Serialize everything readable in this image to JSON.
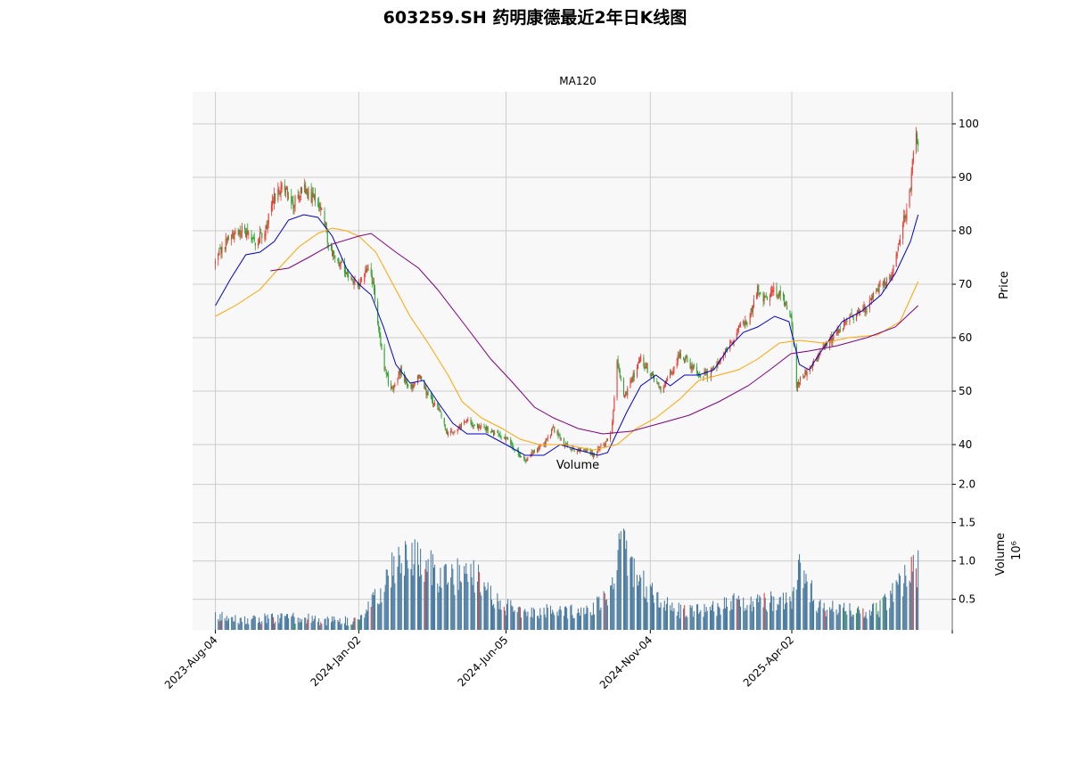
{
  "title": "603259.SH 药明康德最近2年日K线图",
  "chart_data": [
    {
      "type": "candlestick",
      "title": "MA120",
      "ylabel": "Price",
      "ylim": [
        34,
        106
      ],
      "yticks": [
        40,
        50,
        60,
        70,
        80,
        90,
        100
      ],
      "xlim": [
        "2023-07-11",
        "2025-09-18"
      ],
      "xticks": [
        "2023-Aug-04",
        "2024-Jan-02",
        "2024-Jun-05",
        "2024-Nov-04",
        "2025-Apr-02"
      ],
      "grid": true,
      "colors": {
        "up": "#e8382f",
        "down": "#2ca02c",
        "background": "#f8f8f8",
        "grid": "#cccccc"
      },
      "close_anchors": [
        [
          "2023-08-04",
          74
        ],
        [
          "2023-08-15",
          78
        ],
        [
          "2023-09-01",
          80
        ],
        [
          "2023-09-15",
          78
        ],
        [
          "2023-09-25",
          80
        ],
        [
          "2023-10-05",
          86
        ],
        [
          "2023-10-15",
          89
        ],
        [
          "2023-10-25",
          85
        ],
        [
          "2023-11-05",
          88
        ],
        [
          "2023-11-15",
          86
        ],
        [
          "2023-11-25",
          84
        ],
        [
          "2023-12-01",
          77
        ],
        [
          "2023-12-10",
          75
        ],
        [
          "2023-12-20",
          72
        ],
        [
          "2024-01-02",
          70
        ],
        [
          "2024-01-10",
          73
        ],
        [
          "2024-01-15",
          72
        ],
        [
          "2024-01-20",
          66
        ],
        [
          "2024-01-28",
          55
        ],
        [
          "2024-02-05",
          50
        ],
        [
          "2024-02-15",
          54
        ],
        [
          "2024-02-25",
          50
        ],
        [
          "2024-03-05",
          53
        ],
        [
          "2024-03-15",
          49
        ],
        [
          "2024-03-25",
          47
        ],
        [
          "2024-04-05",
          42
        ],
        [
          "2024-04-15",
          43
        ],
        [
          "2024-04-25",
          45
        ],
        [
          "2024-05-05",
          43
        ],
        [
          "2024-05-15",
          43
        ],
        [
          "2024-05-25",
          42
        ],
        [
          "2024-06-05",
          41
        ],
        [
          "2024-06-15",
          39
        ],
        [
          "2024-06-25",
          37
        ],
        [
          "2024-07-05",
          39
        ],
        [
          "2024-07-15",
          40
        ],
        [
          "2024-07-25",
          43
        ],
        [
          "2024-08-05",
          40
        ],
        [
          "2024-08-15",
          39
        ],
        [
          "2024-08-25",
          39
        ],
        [
          "2024-09-05",
          38
        ],
        [
          "2024-09-15",
          40
        ],
        [
          "2024-09-24",
          42
        ],
        [
          "2024-09-30",
          55
        ],
        [
          "2024-10-08",
          49
        ],
        [
          "2024-10-15",
          52
        ],
        [
          "2024-10-25",
          56
        ],
        [
          "2024-11-05",
          53
        ],
        [
          "2024-11-15",
          50
        ],
        [
          "2024-11-25",
          53
        ],
        [
          "2024-12-05",
          57
        ],
        [
          "2024-12-15",
          55
        ],
        [
          "2024-12-25",
          53
        ],
        [
          "2025-01-05",
          53
        ],
        [
          "2025-01-15",
          56
        ],
        [
          "2025-01-25",
          58
        ],
        [
          "2025-02-05",
          62
        ],
        [
          "2025-02-15",
          63
        ],
        [
          "2025-02-25",
          69
        ],
        [
          "2025-03-05",
          67
        ],
        [
          "2025-03-15",
          69
        ],
        [
          "2025-03-25",
          67
        ],
        [
          "2025-04-02",
          63
        ],
        [
          "2025-04-07",
          51
        ],
        [
          "2025-04-15",
          53
        ],
        [
          "2025-04-25",
          55
        ],
        [
          "2025-05-05",
          58
        ],
        [
          "2025-05-15",
          60
        ],
        [
          "2025-05-25",
          62
        ],
        [
          "2025-06-05",
          64
        ],
        [
          "2025-06-15",
          65
        ],
        [
          "2025-06-25",
          67
        ],
        [
          "2025-07-05",
          70
        ],
        [
          "2025-07-15",
          71
        ],
        [
          "2025-07-20",
          75
        ],
        [
          "2025-07-25",
          79
        ],
        [
          "2025-08-01",
          84
        ],
        [
          "2025-08-06",
          90
        ],
        [
          "2025-08-10",
          98
        ],
        [
          "2025-08-13",
          96
        ]
      ],
      "moving_averages": [
        {
          "color": "#0000cc",
          "points": [
            [
              "2023-08-04",
              66
            ],
            [
              "2023-08-20",
              71
            ],
            [
              "2023-09-05",
              75.5
            ],
            [
              "2023-09-20",
              76
            ],
            [
              "2023-10-05",
              78
            ],
            [
              "2023-10-20",
              82
            ],
            [
              "2023-11-05",
              83
            ],
            [
              "2023-11-20",
              82.5
            ],
            [
              "2023-12-05",
              79
            ],
            [
              "2023-12-20",
              73
            ],
            [
              "2024-01-02",
              70
            ],
            [
              "2024-01-15",
              68
            ],
            [
              "2024-01-28",
              62
            ],
            [
              "2024-02-10",
              55
            ],
            [
              "2024-02-25",
              51.5
            ],
            [
              "2024-03-10",
              52
            ],
            [
              "2024-03-25",
              48
            ],
            [
              "2024-04-10",
              44
            ],
            [
              "2024-04-25",
              42
            ],
            [
              "2024-05-15",
              42
            ],
            [
              "2024-06-05",
              40
            ],
            [
              "2024-06-25",
              38
            ],
            [
              "2024-07-15",
              38
            ],
            [
              "2024-08-01",
              40
            ],
            [
              "2024-08-20",
              39
            ],
            [
              "2024-09-10",
              38
            ],
            [
              "2024-09-20",
              38.5
            ],
            [
              "2024-10-10",
              46
            ],
            [
              "2024-10-25",
              51
            ],
            [
              "2024-11-10",
              53
            ],
            [
              "2024-11-25",
              51
            ],
            [
              "2024-12-10",
              53
            ],
            [
              "2024-12-25",
              53
            ],
            [
              "2025-01-10",
              54
            ],
            [
              "2025-01-25",
              58
            ],
            [
              "2025-02-10",
              61
            ],
            [
              "2025-02-25",
              62
            ],
            [
              "2025-03-15",
              64
            ],
            [
              "2025-03-30",
              63
            ],
            [
              "2025-04-10",
              55
            ],
            [
              "2025-04-20",
              54
            ],
            [
              "2025-05-05",
              58
            ],
            [
              "2025-05-25",
              63
            ],
            [
              "2025-06-15",
              65
            ],
            [
              "2025-07-05",
              68
            ],
            [
              "2025-07-20",
              72
            ],
            [
              "2025-08-05",
              78
            ],
            [
              "2025-08-13",
              83
            ]
          ]
        },
        {
          "color": "#ffa500",
          "points": [
            [
              "2023-08-04",
              64
            ],
            [
              "2023-08-25",
              66
            ],
            [
              "2023-09-20",
              69
            ],
            [
              "2023-10-10",
              73
            ],
            [
              "2023-10-31",
              77
            ],
            [
              "2023-11-20",
              79.5
            ],
            [
              "2023-12-05",
              80.5
            ],
            [
              "2023-12-20",
              80
            ],
            [
              "2024-01-02",
              79
            ],
            [
              "2024-01-20",
              76
            ],
            [
              "2024-02-10",
              69
            ],
            [
              "2024-02-25",
              64
            ],
            [
              "2024-03-15",
              59
            ],
            [
              "2024-04-05",
              53
            ],
            [
              "2024-04-20",
              48
            ],
            [
              "2024-05-10",
              45
            ],
            [
              "2024-06-01",
              43
            ],
            [
              "2024-06-20",
              41
            ],
            [
              "2024-07-10",
              40
            ],
            [
              "2024-08-05",
              40
            ],
            [
              "2024-09-05",
              39
            ],
            [
              "2024-09-30",
              40
            ],
            [
              "2024-10-20",
              43
            ],
            [
              "2024-11-10",
              45
            ],
            [
              "2024-12-05",
              48.5
            ],
            [
              "2024-12-25",
              52
            ],
            [
              "2025-01-15",
              53
            ],
            [
              "2025-02-05",
              54
            ],
            [
              "2025-02-25",
              56
            ],
            [
              "2025-03-20",
              59
            ],
            [
              "2025-04-10",
              59.5
            ],
            [
              "2025-05-05",
              59
            ],
            [
              "2025-06-01",
              60
            ],
            [
              "2025-07-01",
              60.5
            ],
            [
              "2025-07-25",
              63
            ],
            [
              "2025-08-13",
              70.5
            ]
          ]
        },
        {
          "color": "#800080",
          "points": [
            [
              "2023-10-01",
              72.5
            ],
            [
              "2023-10-20",
              73
            ],
            [
              "2023-11-10",
              75
            ],
            [
              "2023-12-05",
              77.5
            ],
            [
              "2024-01-02",
              79
            ],
            [
              "2024-01-15",
              79.5
            ],
            [
              "2024-02-10",
              76
            ],
            [
              "2024-03-05",
              73
            ],
            [
              "2024-03-25",
              69
            ],
            [
              "2024-04-20",
              63
            ],
            [
              "2024-05-20",
              56
            ],
            [
              "2024-06-10",
              52
            ],
            [
              "2024-07-05",
              47
            ],
            [
              "2024-07-25",
              45
            ],
            [
              "2024-08-20",
              43
            ],
            [
              "2024-09-15",
              42
            ],
            [
              "2024-10-15",
              42.5
            ],
            [
              "2024-11-15",
              44
            ],
            [
              "2024-12-15",
              45.5
            ],
            [
              "2025-01-15",
              48
            ],
            [
              "2025-02-15",
              51
            ],
            [
              "2025-03-10",
              54
            ],
            [
              "2025-04-01",
              57
            ],
            [
              "2025-04-20",
              57.5
            ],
            [
              "2025-05-20",
              58.5
            ],
            [
              "2025-06-20",
              60
            ],
            [
              "2025-07-20",
              62
            ],
            [
              "2025-08-13",
              66
            ]
          ]
        }
      ]
    },
    {
      "type": "bar",
      "title": "Volume",
      "ylabel": "Volume",
      "yunit": "10⁶",
      "ylim": [
        0.1,
        2.1
      ],
      "yticks": [
        "0.5",
        "1.0",
        "1.5",
        "2.0"
      ],
      "grid": true,
      "colors": {
        "bar": "#4a7aa0",
        "up": "#e8382f",
        "down": "#2ca02c"
      },
      "volume_anchors": [
        [
          "2023-08-04",
          0.3
        ],
        [
          "2023-09-01",
          0.22
        ],
        [
          "2023-10-01",
          0.25
        ],
        [
          "2023-11-01",
          0.25
        ],
        [
          "2023-12-01",
          0.22
        ],
        [
          "2024-01-02",
          0.22
        ],
        [
          "2024-01-25",
          0.6
        ],
        [
          "2024-02-10",
          1.0
        ],
        [
          "2024-03-01",
          1.1
        ],
        [
          "2024-04-01",
          0.75
        ],
        [
          "2024-05-01",
          0.85
        ],
        [
          "2024-05-15",
          0.6
        ],
        [
          "2024-06-01",
          0.4
        ],
        [
          "2024-07-01",
          0.35
        ],
        [
          "2024-08-01",
          0.35
        ],
        [
          "2024-09-01",
          0.32
        ],
        [
          "2024-09-24",
          0.6
        ],
        [
          "2024-10-05",
          1.25
        ],
        [
          "2024-10-20",
          0.8
        ],
        [
          "2024-11-05",
          0.6
        ],
        [
          "2024-12-01",
          0.35
        ],
        [
          "2025-01-01",
          0.35
        ],
        [
          "2025-02-01",
          0.45
        ],
        [
          "2025-03-01",
          0.45
        ],
        [
          "2025-04-02",
          0.5
        ],
        [
          "2025-04-10",
          0.9
        ],
        [
          "2025-05-01",
          0.4
        ],
        [
          "2025-06-01",
          0.35
        ],
        [
          "2025-07-01",
          0.35
        ],
        [
          "2025-07-20",
          0.6
        ],
        [
          "2025-08-13",
          0.95
        ]
      ]
    }
  ]
}
